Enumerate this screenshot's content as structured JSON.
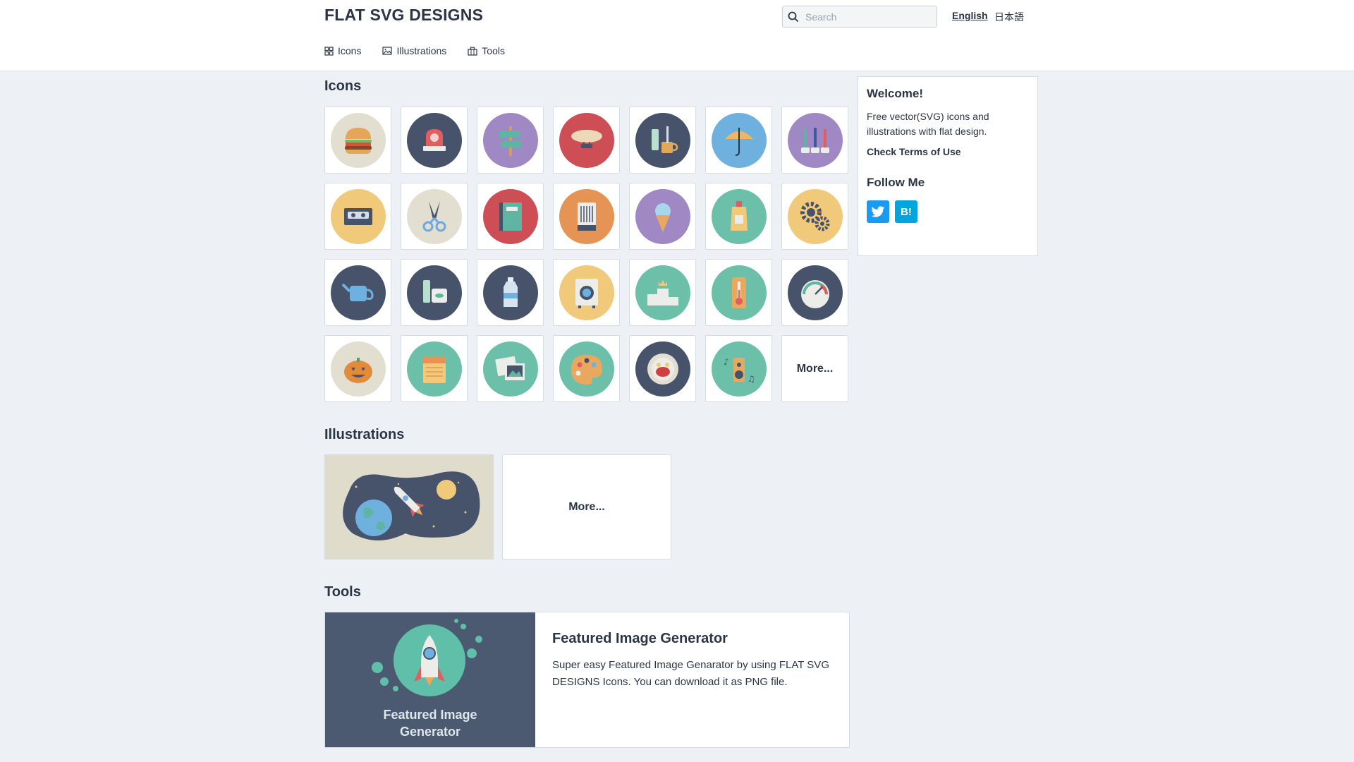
{
  "header": {
    "brand": "FLAT SVG DESIGNS",
    "search": {
      "placeholder": "Search",
      "value": ""
    },
    "languages": [
      {
        "label": "English",
        "active": true
      },
      {
        "label": "日本語",
        "active": false
      }
    ],
    "nav": [
      {
        "label": "Icons",
        "icon": "grid-icon"
      },
      {
        "label": "Illustrations",
        "icon": "image-icon"
      },
      {
        "label": "Tools",
        "icon": "toolbox-icon"
      }
    ]
  },
  "icons_section": {
    "title": "Icons",
    "items": [
      {
        "name": "hamburger",
        "bg": "#e2dfd0"
      },
      {
        "name": "siren",
        "bg": "#46536b"
      },
      {
        "name": "signpost",
        "bg": "#9f88c3"
      },
      {
        "name": "airship",
        "bg": "#cd4f55"
      },
      {
        "name": "toothpaste-mug",
        "bg": "#46536b"
      },
      {
        "name": "umbrella",
        "bg": "#6fb1de"
      },
      {
        "name": "toothbrushes",
        "bg": "#9f88c3"
      },
      {
        "name": "cassette-tape",
        "bg": "#f1c97a"
      },
      {
        "name": "scissors",
        "bg": "#e2dfd0"
      },
      {
        "name": "notebook",
        "bg": "#cd4f55"
      },
      {
        "name": "heater",
        "bg": "#e59455"
      },
      {
        "name": "ice-cream",
        "bg": "#9f88c3"
      },
      {
        "name": "sunscreen",
        "bg": "#6cbfa8"
      },
      {
        "name": "gears",
        "bg": "#f1c97a"
      },
      {
        "name": "watering-can",
        "bg": "#46536b"
      },
      {
        "name": "cosmetics",
        "bg": "#46536b"
      },
      {
        "name": "water-bottle",
        "bg": "#46536b"
      },
      {
        "name": "washing-machine",
        "bg": "#f1c97a"
      },
      {
        "name": "podium",
        "bg": "#6cbfa8"
      },
      {
        "name": "thermometer",
        "bg": "#6cbfa8"
      },
      {
        "name": "speedometer",
        "bg": "#46536b"
      },
      {
        "name": "jack-o-lantern",
        "bg": "#e2dfd0"
      },
      {
        "name": "potato-chips",
        "bg": "#6cbfa8"
      },
      {
        "name": "photos",
        "bg": "#6cbfa8"
      },
      {
        "name": "paint-palette",
        "bg": "#6cbfa8"
      },
      {
        "name": "pasta-plate",
        "bg": "#46536b"
      },
      {
        "name": "speaker-music",
        "bg": "#6cbfa8"
      }
    ],
    "more_label": "More..."
  },
  "illustrations_section": {
    "title": "Illustrations",
    "items": [
      {
        "name": "space-rocket-illustration"
      }
    ],
    "more_label": "More..."
  },
  "tools_section": {
    "title": "Tools",
    "card": {
      "thumb_label_line1": "Featured Image",
      "thumb_label_line2": "Generator",
      "title": "Featured Image Generator",
      "description": "Super easy Featured Image Genarator by using FLAT SVG DESIGNS Icons. You can download it as PNG file."
    }
  },
  "sidebar": {
    "welcome_title": "Welcome!",
    "welcome_text": "Free vector(SVG) icons and illustrations with flat design.",
    "terms_link": "Check Terms of Use",
    "follow_title": "Follow Me",
    "social": [
      {
        "name": "twitter",
        "color": "#1b9bf0"
      },
      {
        "name": "hatena-bookmark",
        "label": "B!",
        "color": "#00a4de"
      }
    ]
  }
}
